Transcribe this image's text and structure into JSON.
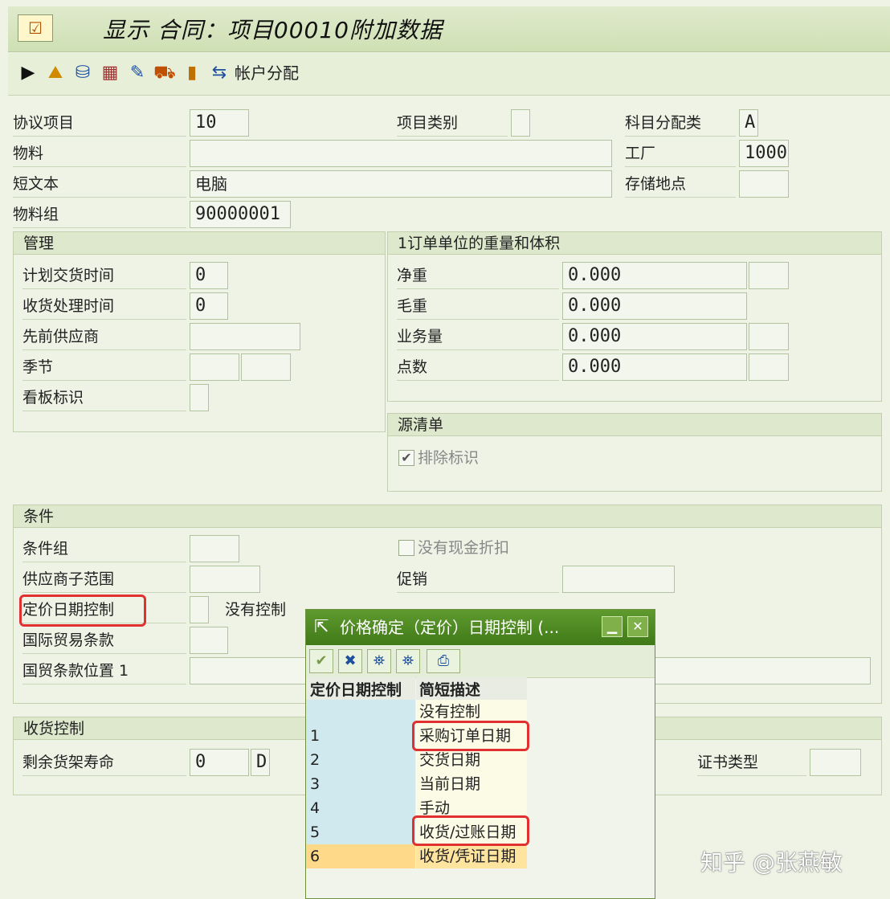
{
  "window": {
    "title": "显示 合同：项目00010附加数据"
  },
  "toolbar": {
    "account_assignment_label": "帐户分配"
  },
  "header_fields": {
    "agreement_item_label": "协议项目",
    "agreement_item_value": "10",
    "item_category_label": "项目类别",
    "item_category_value": "",
    "acct_assign_cat_label": "科目分配类",
    "acct_assign_cat_value": "A",
    "material_label": "物料",
    "material_value": "",
    "plant_label": "工厂",
    "plant_value": "1000",
    "short_text_label": "短文本",
    "short_text_value": "电脑",
    "storage_loc_label": "存储地点",
    "storage_loc_value": "",
    "material_group_label": "物料组",
    "material_group_value": "90000001"
  },
  "admin": {
    "title": "管理",
    "planned_delivery_label": "计划交货时间",
    "planned_delivery_value": "0",
    "gr_processing_label": "收货处理时间",
    "gr_processing_value": "0",
    "prior_vendor_label": "先前供应商",
    "prior_vendor_value": "",
    "season_label": "季节",
    "kanban_label": "看板标识"
  },
  "weights": {
    "title": "1订单单位的重量和体积",
    "net_label": "净重",
    "net_value": "0.000",
    "gross_label": "毛重",
    "gross_value": "0.000",
    "volume_label": "业务量",
    "volume_value": "0.000",
    "points_label": "点数",
    "points_value": "0.000"
  },
  "source_list": {
    "title": "源清单",
    "exclusion_label": "排除标识",
    "exclusion_checked": true
  },
  "conditions": {
    "title": "条件",
    "cond_group_label": "条件组",
    "no_cash_discount_label": "没有现金折扣",
    "vendor_subrange_label": "供应商子范围",
    "promotion_label": "促销",
    "pricing_date_label": "定价日期控制",
    "pricing_date_text": "没有控制",
    "incoterms_label": "国际贸易条款",
    "incoterms_loc_label": "国贸条款位置 1"
  },
  "gr_control": {
    "title": "收货控制",
    "shelf_life_label": "剩余货架寿命",
    "shelf_life_value": "0",
    "shelf_life_unit": "D",
    "cert_type_label": "证书类型"
  },
  "popup": {
    "title": "价格确定（定价）日期控制 (...",
    "col_key": "定价日期控制",
    "col_desc": "简短描述",
    "rows": [
      {
        "key": "",
        "desc": "没有控制"
      },
      {
        "key": "1",
        "desc": "采购订单日期"
      },
      {
        "key": "2",
        "desc": "交货日期"
      },
      {
        "key": "3",
        "desc": "当前日期"
      },
      {
        "key": "4",
        "desc": "手动"
      },
      {
        "key": "5",
        "desc": "收货/过账日期"
      },
      {
        "key": "6",
        "desc": "收货/凭证日期"
      }
    ]
  },
  "watermark": "知乎 @张燕敏"
}
